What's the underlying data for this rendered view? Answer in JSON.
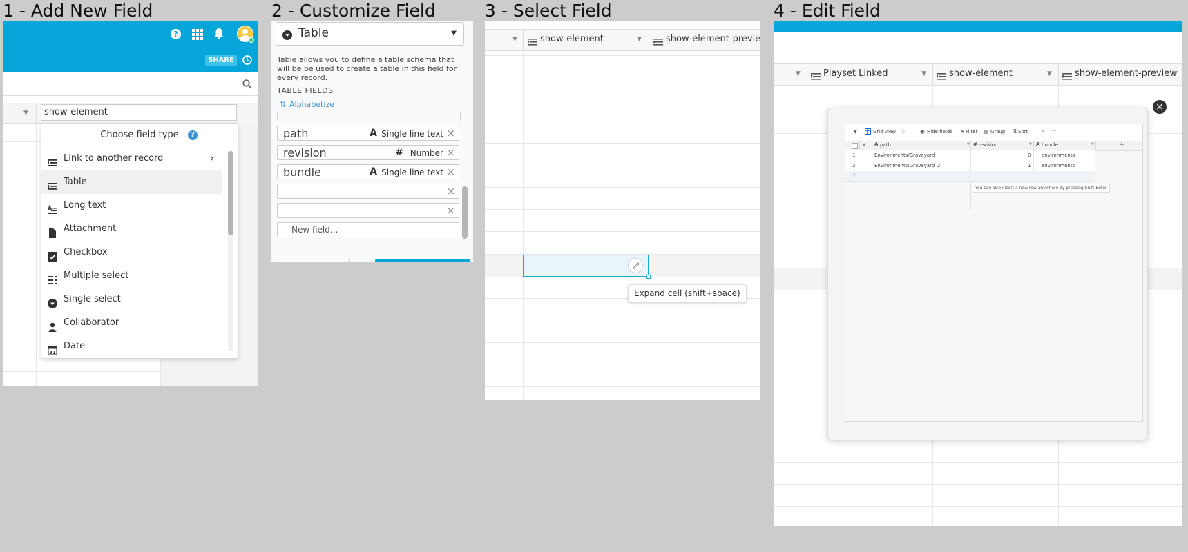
{
  "steps": [
    {
      "title": "1 - Add New Field"
    },
    {
      "title": "2 - Customize Field"
    },
    {
      "title": "3 - Select Field"
    },
    {
      "title": "4 - Edit Field"
    }
  ],
  "panel1": {
    "share_label": "SHARE",
    "field_name_value": "show-element",
    "chooser_title": "Choose field type",
    "field_types": [
      {
        "label": "Link to another record",
        "icon": "link-record-icon"
      },
      {
        "label": "Table",
        "icon": "table-icon"
      },
      {
        "label": "Long text",
        "icon": "long-text-icon"
      },
      {
        "label": "Attachment",
        "icon": "attachment-icon"
      },
      {
        "label": "Checkbox",
        "icon": "checkbox-icon"
      },
      {
        "label": "Multiple select",
        "icon": "multiple-select-icon"
      },
      {
        "label": "Single select",
        "icon": "single-select-icon"
      },
      {
        "label": "Collaborator",
        "icon": "collaborator-icon"
      },
      {
        "label": "Date",
        "icon": "date-icon"
      }
    ],
    "selected_type": "Table"
  },
  "panel2": {
    "type_select": "Table",
    "description": "Table allows you to define a table schema that will be be used to create a table in this field for every record.",
    "section_label": "TABLE FIELDS",
    "alphabetize_label": "Alphabetize",
    "fields": [
      {
        "name": "path",
        "type": "Single line text",
        "icon": "text-icon"
      },
      {
        "name": "revision",
        "type": "Number",
        "icon": "number-icon"
      },
      {
        "name": "bundle",
        "type": "Single line text",
        "icon": "text-icon"
      }
    ],
    "new_field_placeholder": "New field..."
  },
  "panel3": {
    "columns": [
      "show-element",
      "show-element-preview"
    ],
    "tooltip": "Expand cell (shift+space)"
  },
  "panel4": {
    "columns": [
      "Playset Linked",
      "show-element",
      "show-element-preview"
    ],
    "toolbar": {
      "view": "Grid view",
      "hide_fields": "Hide fields",
      "filter": "Filter",
      "group": "Group",
      "sort": "Sort"
    },
    "mini_columns": [
      "path",
      "revision",
      "bundle"
    ],
    "mini_rows": [
      {
        "num": "1",
        "path": "Environments/Graveyard",
        "revision": "0",
        "bundle": "environments"
      },
      {
        "num": "2",
        "path": "Environments/Graveyard_2",
        "revision": "1",
        "bundle": "environments"
      }
    ],
    "hint": "You can also insert a new row anywhere by pressing Shift-Enter"
  },
  "colors": {
    "accent": "#06a6db",
    "selected_cell": "#e8f6fc",
    "cell_border": "#19a8d6"
  }
}
